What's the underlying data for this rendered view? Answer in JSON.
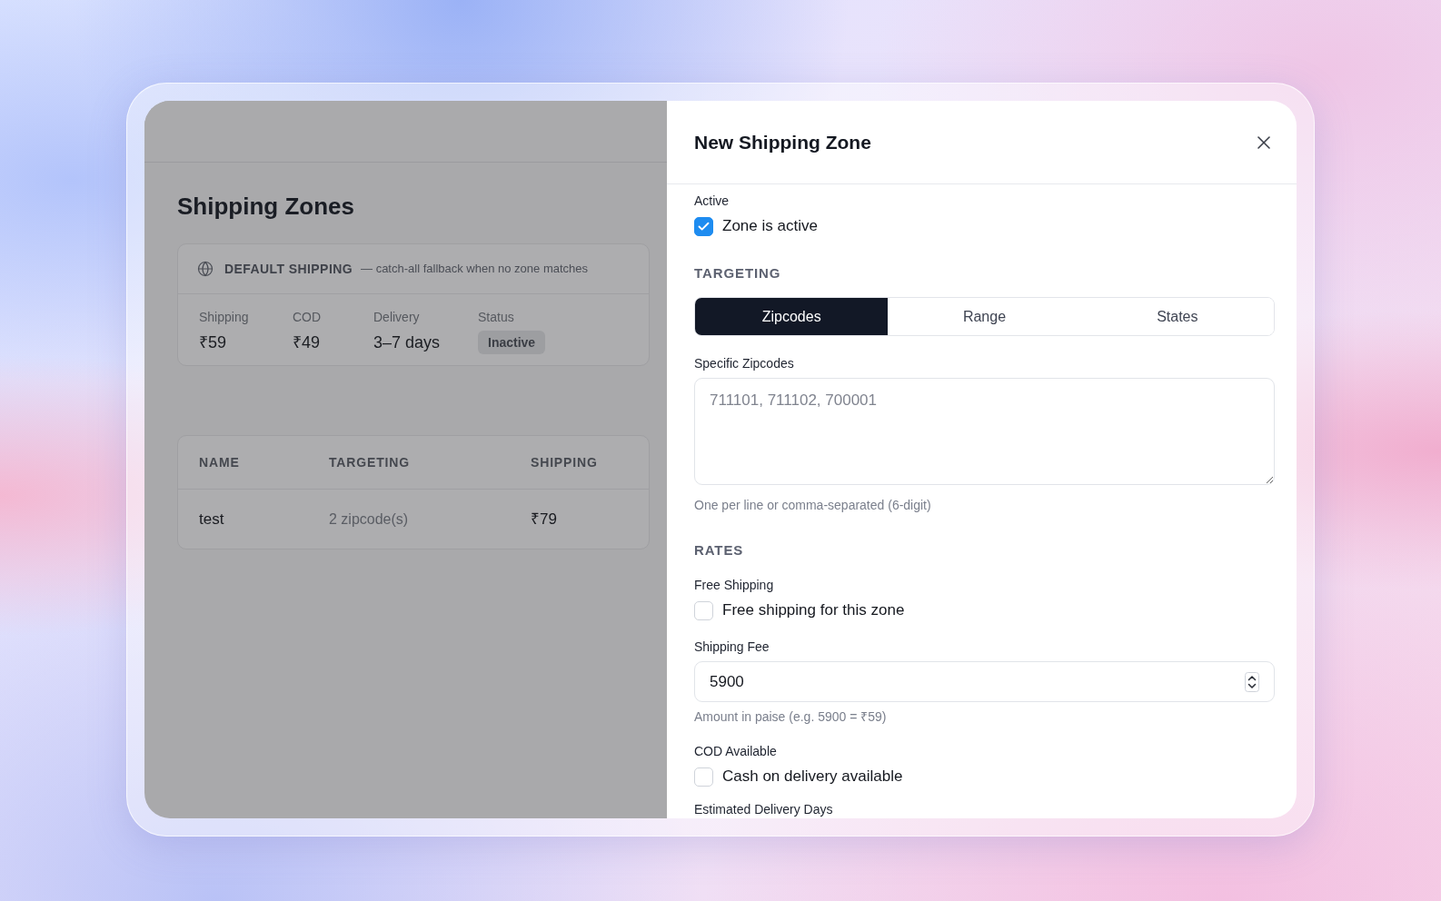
{
  "page": {
    "title": "Shipping Zones"
  },
  "default_shipping": {
    "title": "DEFAULT SHIPPING",
    "description": "— catch-all fallback when no zone matches",
    "stats": [
      {
        "kind": "text",
        "label": "Shipping",
        "value": "₹59"
      },
      {
        "kind": "text",
        "label": "COD",
        "value": "₹49"
      },
      {
        "kind": "text",
        "label": "Delivery",
        "value": "3–7 days"
      },
      {
        "kind": "badge",
        "label": "Status",
        "value": "Inactive"
      }
    ]
  },
  "zones_table": {
    "columns": [
      "NAME",
      "TARGETING",
      "SHIPPING"
    ],
    "rows": [
      [
        "test",
        "2 zipcode(s)",
        "₹79"
      ]
    ]
  },
  "drawer": {
    "title": "New Shipping Zone",
    "form": [
      {
        "kind": "checkbox",
        "label": "Active",
        "text": "Zone is active",
        "checked": true
      },
      {
        "kind": "heading",
        "text": "TARGETING"
      },
      {
        "kind": "tabs",
        "tabs": [
          {
            "label": "Zipcodes",
            "selected": true
          },
          {
            "label": "Range",
            "selected": false
          },
          {
            "label": "States",
            "selected": false
          }
        ]
      },
      {
        "kind": "textarea",
        "label": "Specific Zipcodes",
        "placeholder": "711101, 711102, 700001",
        "hint": "One per line or comma-separated (6-digit)"
      },
      {
        "kind": "heading",
        "text": "RATES"
      },
      {
        "kind": "checkbox",
        "label": "Free Shipping",
        "text": "Free shipping for this zone",
        "checked": false
      },
      {
        "kind": "number",
        "label": "Shipping Fee",
        "value": "5900",
        "hint": "Amount in paise (e.g. 5900 = ₹59)"
      },
      {
        "kind": "checkbox",
        "label": "COD Available",
        "text": "Cash on delivery available",
        "checked": false
      },
      {
        "kind": "label",
        "text": "Estimated Delivery Days"
      }
    ]
  }
}
